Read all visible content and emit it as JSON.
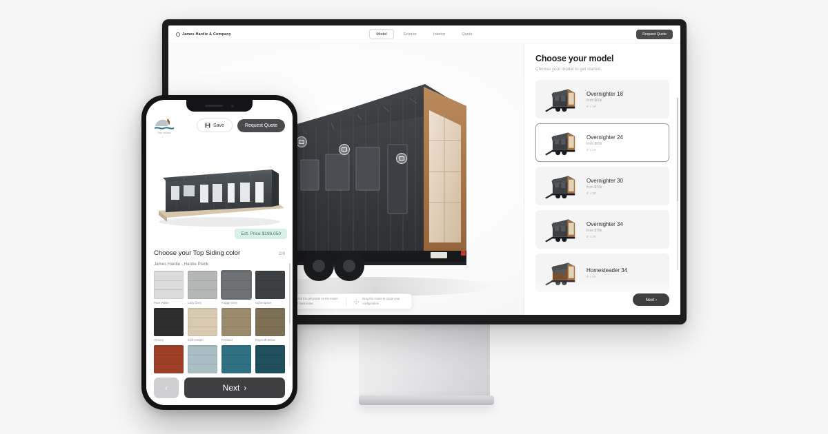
{
  "desktop": {
    "brand": "James Hardie & Company",
    "tabs": [
      {
        "label": "Model",
        "active": true
      },
      {
        "label": "Exterior",
        "active": false
      },
      {
        "label": "Interior",
        "active": false
      },
      {
        "label": "Quote",
        "active": false
      }
    ],
    "request_quote_label": "Request Quote",
    "sidebar": {
      "title": "Choose your model",
      "subtitle": "Choose your model to get started.",
      "next_label": "Next",
      "next_icon": "chevron-right-icon",
      "models": [
        {
          "name": "Overnighter 18",
          "price": "from $60k",
          "dims": "8' x 18'",
          "selected": false
        },
        {
          "name": "Overnighter 24",
          "price": "from $65k",
          "dims": "8' x 24'",
          "selected": true
        },
        {
          "name": "Overnighter 30",
          "price": "from $70k",
          "dims": "8' x 30'",
          "selected": false
        },
        {
          "name": "Overnighter 34",
          "price": "from $75k",
          "dims": "8' x 34'",
          "selected": false
        },
        {
          "name": "Homesteader 34",
          "price": "",
          "dims": "8' x 34'",
          "selected": false
        }
      ]
    },
    "hints": [
      {
        "icon": "pin-icon",
        "text": "Click the pin points on the model to learn more"
      },
      {
        "icon": "drag-icon",
        "text": "Drag the model to rotate your configuration"
      }
    ]
  },
  "phone": {
    "logo_text": "Tiny Homes",
    "save_label": "Save",
    "save_icon": "floppy-disk-icon",
    "request_quote_label": "Request Quote",
    "price_badge": "Est. Price $198,050",
    "panel": {
      "title": "Choose your Top Siding color",
      "step": "2/8",
      "brand_line": "James Hardie  -  Hardie Plank",
      "swatches": [
        {
          "label": "Pure White",
          "color": "#dcdcdc",
          "selected": false
        },
        {
          "label": "Lazy Grey",
          "color": "#b5b7b7",
          "selected": false
        },
        {
          "label": "Foggy Grey",
          "color": "#6e7274",
          "selected": true
        },
        {
          "label": "Cyberspace",
          "color": "#3c4043",
          "selected": false
        },
        {
          "label": "Armory",
          "color": "#2e2e2e",
          "selected": false
        },
        {
          "label": "Irish Cream",
          "color": "#d8cbb2",
          "selected": false
        },
        {
          "label": "Fenland",
          "color": "#9b8a6c",
          "selected": false
        },
        {
          "label": "Raycroft Straw",
          "color": "#7e7054",
          "selected": false
        },
        {
          "label": "",
          "color": "#9c3f26",
          "selected": false
        },
        {
          "label": "",
          "color": "#a9bfc4",
          "selected": false
        },
        {
          "label": "",
          "color": "#2f7083",
          "selected": false
        },
        {
          "label": "",
          "color": "#1f4e5c",
          "selected": false
        }
      ]
    },
    "back_icon": "chevron-left-icon",
    "next_label": "Next",
    "next_icon": "chevron-right-icon"
  }
}
